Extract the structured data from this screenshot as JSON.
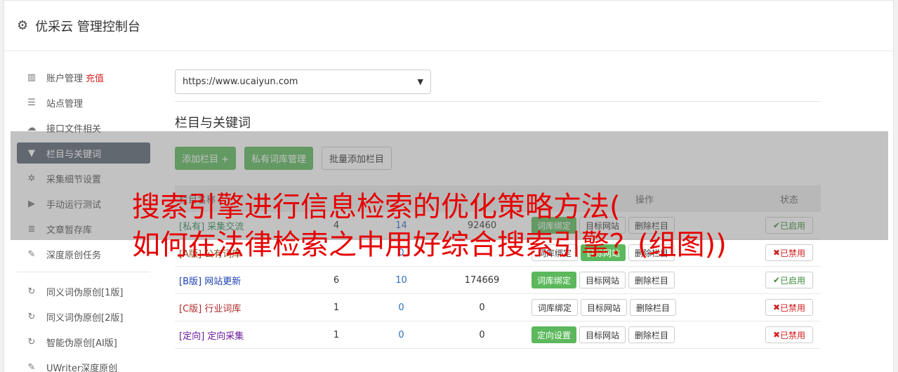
{
  "header": {
    "title": "优采云 管理控制台"
  },
  "sidebar": {
    "items": [
      {
        "label": "账户管理",
        "icon": "bar-chart-icon",
        "extra": "充值"
      },
      {
        "label": "站点管理",
        "icon": "server-icon"
      },
      {
        "label": "接口文件相关",
        "icon": "cloud-upload-icon"
      },
      {
        "label": "栏目与关键词",
        "icon": "filter-icon",
        "active": true
      },
      {
        "label": "采集细节设置",
        "icon": "cogs-icon"
      },
      {
        "label": "手动运行测试",
        "icon": "play-icon"
      },
      {
        "label": "文章暂存库",
        "icon": "database-icon"
      },
      {
        "label": "深度原创任务",
        "icon": "edit-icon"
      },
      {
        "label": "同义词伪原创[1版]",
        "icon": "refresh-icon"
      },
      {
        "label": "同义词伪原创[2版]",
        "icon": "refresh-icon"
      },
      {
        "label": "智能伪原创[AI版]",
        "icon": "refresh-icon"
      },
      {
        "label": "UWriter深度原创",
        "icon": "edit-icon"
      }
    ]
  },
  "main": {
    "site_select": "https://www.ucaiyun.com",
    "section_title": "栏目与关键词",
    "buttons": {
      "add": "添加栏目 +",
      "private": "私有词库管理",
      "batch": "批量添加栏目"
    },
    "table": {
      "headers": {
        "name": "栏目名称",
        "ops": "操作",
        "status": "状态"
      },
      "rows": [
        {
          "tag": "[私有]",
          "name": "采集交流",
          "a": "4",
          "b": "14",
          "c": "92460",
          "op1": "词库绑定",
          "op2": "目标网站",
          "op3": "删除栏目",
          "status": "已启用",
          "on": true,
          "op1_green": true
        },
        {
          "tag": "[A版]",
          "name": "公有词库",
          "a": "",
          "b": "0",
          "c": "",
          "op1": "词库绑定",
          "op2": "目标网站",
          "op3": "删除栏目",
          "status": "已禁用",
          "on": false,
          "op1_green": false
        },
        {
          "tag": "[B版]",
          "name": "网站更新",
          "a": "6",
          "b": "10",
          "c": "174669",
          "op1": "词库绑定",
          "op2": "目标网站",
          "op3": "删除栏目",
          "status": "已启用",
          "on": true,
          "op1_green": true
        },
        {
          "tag": "[C版]",
          "name": "行业词库",
          "a": "1",
          "b": "0",
          "c": "0",
          "op1": "词库绑定",
          "op2": "目标网站",
          "op3": "删除栏目",
          "status": "已禁用",
          "on": false,
          "op1_green": false
        },
        {
          "tag": "[定向]",
          "name": "定向采集",
          "a": "1",
          "b": "0",
          "c": "0",
          "op1": "定向设置",
          "op2": "目标网站",
          "op3": "删除栏目",
          "status": "已禁用",
          "on": false,
          "op1_green": true
        }
      ]
    }
  },
  "overlay": {
    "line1": "搜索引擎进行信息检索的优化策略方法(",
    "line2": "如何在法律检索之中用好综合搜索引擎？(组图))"
  }
}
